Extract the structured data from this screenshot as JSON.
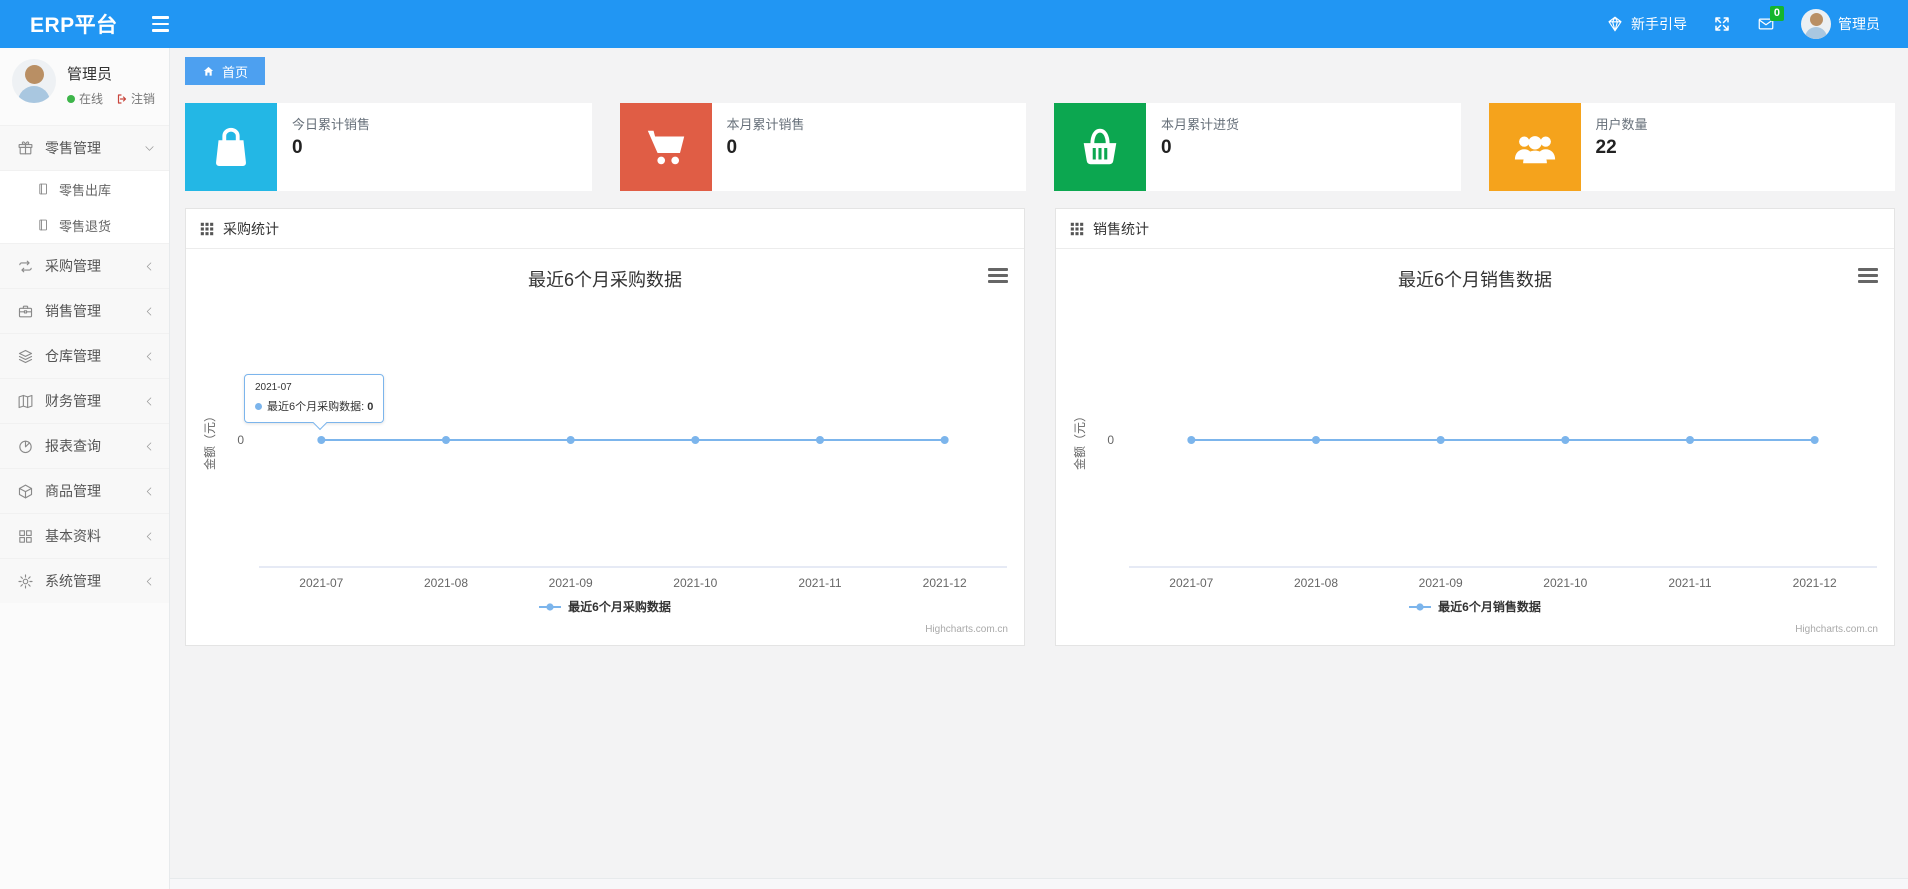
{
  "topbar": {
    "brand": "ERP平台",
    "guide_label": "新手引导",
    "mail_badge": "0",
    "user_name": "管理员"
  },
  "sidebar": {
    "user": {
      "name": "管理员",
      "status": "在线",
      "logout": "注销"
    },
    "menu": [
      {
        "label": "零售管理",
        "icon": "gift-icon",
        "state": "expanded",
        "children": [
          {
            "label": "零售出库",
            "icon": "doc-icon"
          },
          {
            "label": "零售退货",
            "icon": "doc-icon"
          }
        ]
      },
      {
        "label": "采购管理",
        "icon": "repeat-icon",
        "state": "collapsed"
      },
      {
        "label": "销售管理",
        "icon": "briefcase-icon",
        "state": "collapsed"
      },
      {
        "label": "仓库管理",
        "icon": "layers-icon",
        "state": "collapsed"
      },
      {
        "label": "财务管理",
        "icon": "map-icon",
        "state": "collapsed"
      },
      {
        "label": "报表查询",
        "icon": "pie-icon",
        "state": "collapsed"
      },
      {
        "label": "商品管理",
        "icon": "cube-icon",
        "state": "collapsed"
      },
      {
        "label": "基本资料",
        "icon": "grid-icon",
        "state": "collapsed"
      },
      {
        "label": "系统管理",
        "icon": "gear-icon",
        "state": "collapsed"
      }
    ]
  },
  "tabs": [
    {
      "label": "首页",
      "active": true
    }
  ],
  "cards": [
    {
      "label": "今日累计销售",
      "value": "0",
      "color": "#23b7e5",
      "icon": "shopping-bag-icon"
    },
    {
      "label": "本月累计销售",
      "value": "0",
      "color": "#e05d45",
      "icon": "shopping-cart-icon"
    },
    {
      "label": "本月累计进货",
      "value": "0",
      "color": "#0ca750",
      "icon": "shopping-basket-icon"
    },
    {
      "label": "用户数量",
      "value": "22",
      "color": "#f5a31c",
      "icon": "users-icon"
    }
  ],
  "panels": [
    {
      "title": "采购统计"
    },
    {
      "title": "销售统计"
    }
  ],
  "colors": {
    "topbar_blue": "#2196f3",
    "tab_blue": "#4da0f0",
    "series_line": "#7cb5ec",
    "badge_green": "#15b52d",
    "online_dot_green": "#3db54a",
    "logout_red": "#c9463d"
  },
  "chart_data": [
    {
      "type": "line",
      "title": "最近6个月采购数据",
      "categories": [
        "2021-07",
        "2021-08",
        "2021-09",
        "2021-10",
        "2021-11",
        "2021-12"
      ],
      "series": [
        {
          "name": "最近6个月采购数据",
          "values": [
            0,
            0,
            0,
            0,
            0,
            0
          ]
        }
      ],
      "xlabel": "",
      "ylabel": "金额（元）",
      "yticks": [
        "0"
      ],
      "grid": false,
      "legend_position": "bottom",
      "credit": "Highcharts.com.cn",
      "tooltip": {
        "category": "2021-07",
        "series_name": "最近6个月采购数据",
        "value": "0"
      }
    },
    {
      "type": "line",
      "title": "最近6个月销售数据",
      "categories": [
        "2021-07",
        "2021-08",
        "2021-09",
        "2021-10",
        "2021-11",
        "2021-12"
      ],
      "series": [
        {
          "name": "最近6个月销售数据",
          "values": [
            0,
            0,
            0,
            0,
            0,
            0
          ]
        }
      ],
      "xlabel": "",
      "ylabel": "金额（元）",
      "yticks": [
        "0"
      ],
      "grid": false,
      "legend_position": "bottom",
      "credit": "Highcharts.com.cn",
      "tooltip": null
    }
  ]
}
